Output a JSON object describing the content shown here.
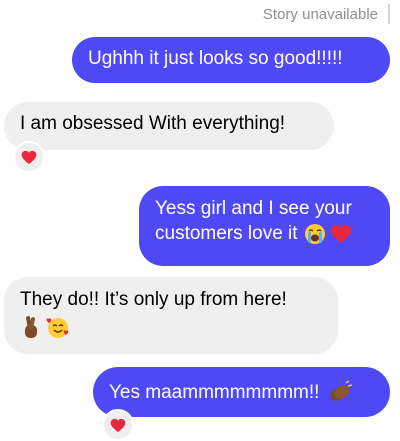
{
  "header": {
    "story_status": "Story unavailable"
  },
  "messages": [
    {
      "sender": "me",
      "text": "Ughhh it just looks so good!!!!!"
    },
    {
      "sender": "them",
      "text": "I am obsessed With everything!",
      "reaction": "red-heart"
    },
    {
      "sender": "me",
      "line1": "Yess girl and I see your",
      "line2": "customers love it",
      "emojis": [
        "loudly-crying-face",
        "red-heart"
      ]
    },
    {
      "sender": "them",
      "text": "They do!! It’s only up from here!",
      "emojis": [
        "crossed-fingers-medium-dark-skin",
        "smiling-face-with-hearts"
      ]
    },
    {
      "sender": "me",
      "text": "Yes maammmmmmmm!!",
      "emojis": [
        "clapping-hands-medium-dark-skin"
      ],
      "reaction": "red-heart"
    }
  ],
  "colors": {
    "sent_bubble": "#4f49f5",
    "received_bubble": "#efeff0",
    "heart": "#e8283a"
  }
}
